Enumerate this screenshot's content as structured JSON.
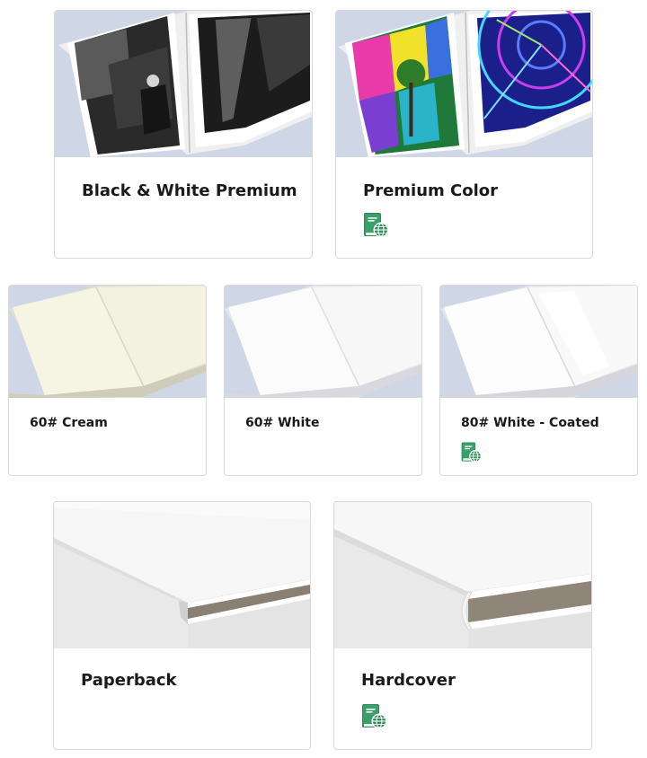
{
  "row1": [
    {
      "title": "Black & White Premium",
      "badge": false,
      "image": "bw-photo-book-image"
    },
    {
      "title": "Premium Color",
      "badge": true,
      "badge_icon": "print-distribution-book-globe-icon",
      "image": "color-photo-book-image"
    }
  ],
  "row2": [
    {
      "title": "60# Cream",
      "badge": false,
      "image": "cream-paper-book-image"
    },
    {
      "title": "60# White",
      "badge": false,
      "image": "white-paper-book-image"
    },
    {
      "title": "80# White - Coated",
      "badge": true,
      "badge_icon": "print-distribution-book-globe-icon",
      "image": "coated-paper-book-image"
    }
  ],
  "row3": [
    {
      "title": "Paperback",
      "badge": false,
      "image": "paperback-binding-image"
    },
    {
      "title": "Hardcover",
      "badge": true,
      "badge_icon": "print-distribution-book-globe-icon",
      "image": "hardcover-binding-image"
    }
  ],
  "colors": {
    "badge_green": "#2e8b57",
    "image_bg": "#cfd6e6",
    "border": "#d9d9d9"
  }
}
